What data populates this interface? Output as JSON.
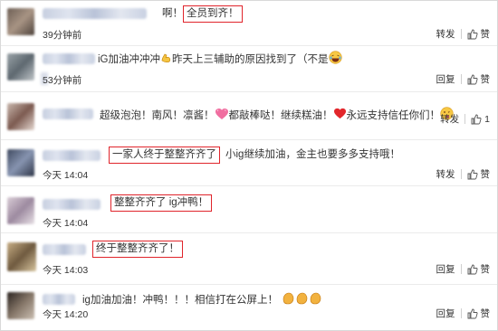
{
  "comments": [
    {
      "pre": "啊！",
      "highlight": "全员到齐！",
      "post": "",
      "time": "39分钟前",
      "action": "转发",
      "like_label": "赞",
      "like_count": "",
      "avatar_color": "#8c7d6e"
    },
    {
      "pre": "iG加油冲冲冲",
      "emoji1": "muscle",
      "mid": "昨天上三辅助的原因找到了（不是",
      "emoji2": "laugh",
      "time": "53分钟前",
      "action": "回复",
      "like_label": "赞",
      "like_count": "",
      "avatar_color": "#7f8a92"
    },
    {
      "text1": "超级泡泡！南风！凛酱！",
      "emoji1": "heart-pink",
      "text2": "都敲棒哒！继续糕油！",
      "emoji2": "heart-red",
      "text3": "永远支持信任你们！",
      "emoji3": "tongue",
      "time": "",
      "action": "转发",
      "like_label": "",
      "like_count": "1",
      "avatar_color": "#9a7f74"
    },
    {
      "highlight": "一家人终于整整齐齐了",
      "post": "小ig继续加油，金主也要多多支持哦！",
      "time": "今天 14:04",
      "action": "转发",
      "like_label": "赞",
      "like_count": "",
      "avatar_color": "#5f6a80"
    },
    {
      "highlight": "整整齐齐了 ig冲鸭！",
      "post": "",
      "time": "今天 14:04",
      "action": "",
      "like_label": "",
      "like_count": "",
      "avatar_color": "#b6a7b3"
    },
    {
      "highlight": "终于整整齐齐了！",
      "post": "",
      "time": "今天 14:03",
      "action": "回复",
      "like_label": "赞",
      "like_count": "",
      "avatar_color": "#9c8461"
    },
    {
      "text": "ig加油加油！冲鸭！！！相信打在公屏上！",
      "emoji": "clap",
      "time": "今天 14:20",
      "action": "回复",
      "like_label": "赞",
      "like_count": "",
      "avatar_color": "#5a5148"
    }
  ]
}
